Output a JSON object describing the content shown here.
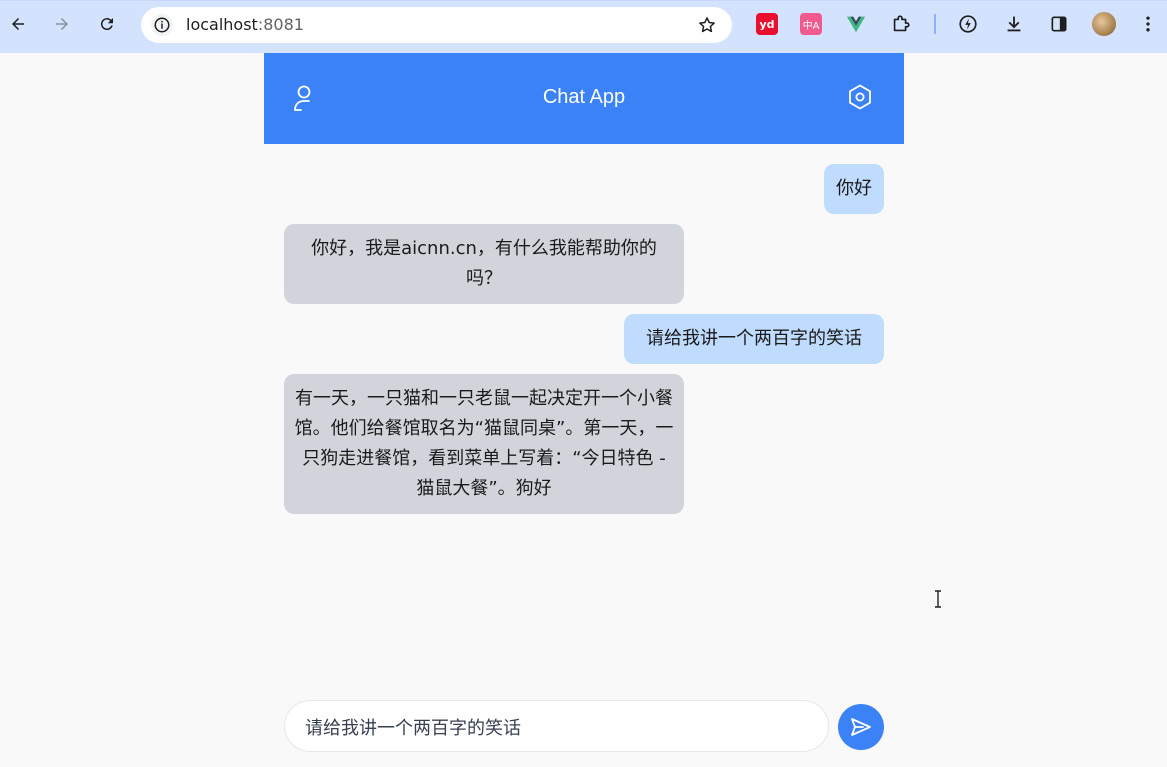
{
  "browser": {
    "url_host": "localhost",
    "url_port": ":8081",
    "extensions": [
      "youdao-icon",
      "translate-icon",
      "vue-devtools-icon",
      "extensions-puzzle-icon",
      "performance-icon"
    ],
    "ext_yd_label": "yd",
    "ext_tr_label": "中A"
  },
  "header": {
    "title": "Chat App"
  },
  "messages": [
    {
      "role": "user",
      "text": "你好"
    },
    {
      "role": "bot",
      "text": "你好，我是aicnn.cn，有什么我能帮助你的吗？"
    },
    {
      "role": "user",
      "text": "请给我讲一个两百字的笑话"
    },
    {
      "role": "bot",
      "text": "有一天，一只猫和一只老鼠一起决定开一个小餐馆。他们给餐馆取名为“猫鼠同桌”。第一天，一只狗走进餐馆，看到菜单上写着：“今日特色 - 猫鼠大餐”。狗好"
    }
  ],
  "composer": {
    "value": "请给我讲一个两百字的笑话"
  },
  "colors": {
    "accent": "#3b82f6",
    "user_bubble": "#bfdbfe",
    "bot_bubble": "#d1d5db",
    "chrome_bg": "#d3e3fd"
  }
}
